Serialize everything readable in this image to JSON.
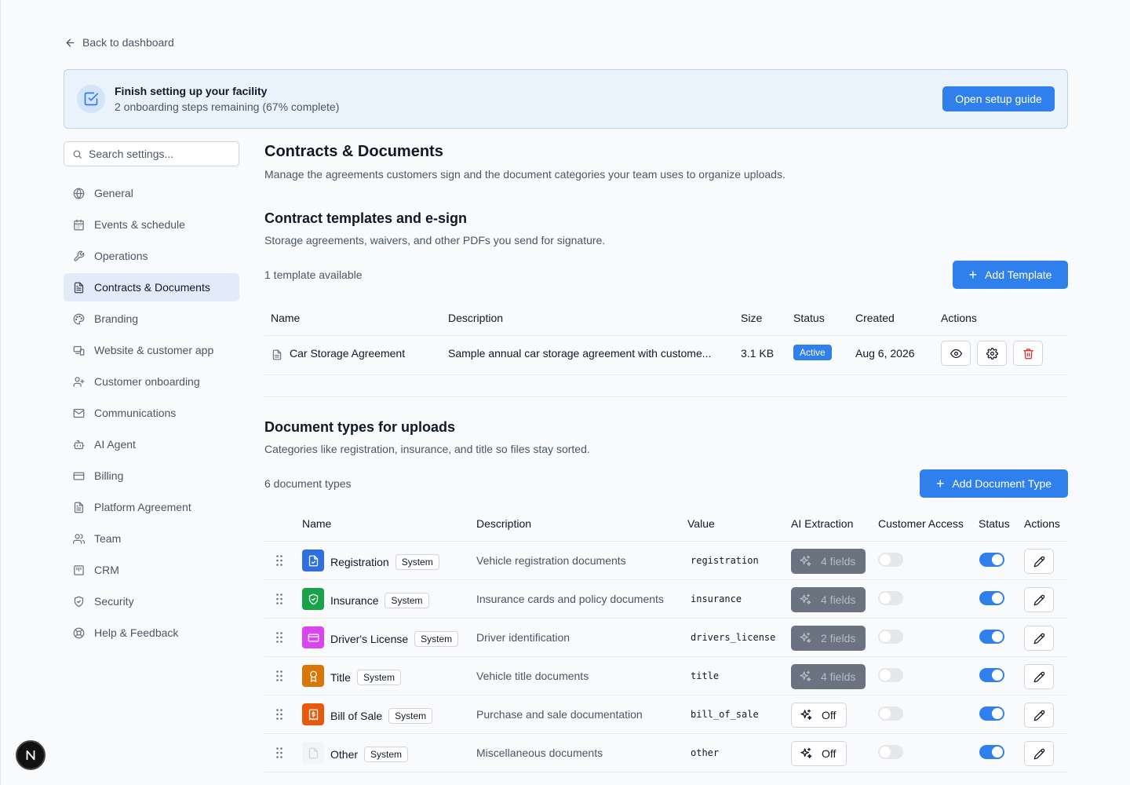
{
  "back_link": "Back to dashboard",
  "banner": {
    "title": "Finish setting up your facility",
    "subtitle": "2 onboarding steps remaining (67% complete)",
    "button": "Open setup guide"
  },
  "search": {
    "placeholder": "Search settings..."
  },
  "sidebar": {
    "items": [
      {
        "label": "General",
        "icon": "globe-icon"
      },
      {
        "label": "Events & schedule",
        "icon": "calendar-icon"
      },
      {
        "label": "Operations",
        "icon": "wrench-icon"
      },
      {
        "label": "Contracts & Documents",
        "icon": "file-text-icon",
        "active": true
      },
      {
        "label": "Branding",
        "icon": "palette-icon"
      },
      {
        "label": "Website & customer app",
        "icon": "devices-icon"
      },
      {
        "label": "Customer onboarding",
        "icon": "user-plus-icon"
      },
      {
        "label": "Communications",
        "icon": "mail-icon"
      },
      {
        "label": "AI Agent",
        "icon": "bot-icon"
      },
      {
        "label": "Billing",
        "icon": "credit-card-icon"
      },
      {
        "label": "Platform Agreement",
        "icon": "file-text-icon"
      },
      {
        "label": "Team",
        "icon": "users-icon"
      },
      {
        "label": "CRM",
        "icon": "contact-icon"
      },
      {
        "label": "Security",
        "icon": "shield-icon"
      },
      {
        "label": "Help & Feedback",
        "icon": "lifebuoy-icon"
      }
    ]
  },
  "page": {
    "title": "Contracts & Documents",
    "subtitle": "Manage the agreements customers sign and the document categories your team uses to organize uploads."
  },
  "templates": {
    "title": "Contract templates and e-sign",
    "subtitle": "Storage agreements, waivers, and other PDFs you send for signature.",
    "count": "1 template available",
    "add_button": "Add Template",
    "columns": [
      "Name",
      "Description",
      "Size",
      "Status",
      "Created",
      "Actions"
    ],
    "rows": [
      {
        "name": "Car Storage Agreement",
        "description": "Sample annual car storage agreement with custome...",
        "size": "3.1 KB",
        "status": "Active",
        "created": "Aug 6, 2026"
      }
    ]
  },
  "doc_types": {
    "title": "Document types for uploads",
    "subtitle": "Categories like registration, insurance, and title so files stay sorted.",
    "count": "6 document types",
    "add_button": "Add Document Type",
    "columns": [
      "Name",
      "Description",
      "Value",
      "AI Extraction",
      "Customer Access",
      "Status",
      "Actions"
    ],
    "rows": [
      {
        "name": "Registration",
        "tag": "System",
        "description": "Vehicle registration documents",
        "value": "registration",
        "ai": "4 fields",
        "ai_on": true,
        "customer_access": false,
        "status": true,
        "icon_color": "#2f6fdf",
        "icon": "file-check-icon"
      },
      {
        "name": "Insurance",
        "tag": "System",
        "description": "Insurance cards and policy documents",
        "value": "insurance",
        "ai": "4 fields",
        "ai_on": true,
        "customer_access": false,
        "status": true,
        "icon_color": "#16a34a",
        "icon": "shield-icon"
      },
      {
        "name": "Driver's License",
        "tag": "System",
        "description": "Driver identification",
        "value": "drivers_license",
        "ai": "2 fields",
        "ai_on": true,
        "customer_access": false,
        "status": true,
        "icon_color": "#d946ef",
        "icon": "id-card-icon"
      },
      {
        "name": "Title",
        "tag": "System",
        "description": "Vehicle title documents",
        "value": "title",
        "ai": "4 fields",
        "ai_on": true,
        "customer_access": false,
        "status": true,
        "icon_color": "#d97706",
        "icon": "award-icon"
      },
      {
        "name": "Bill of Sale",
        "tag": "System",
        "description": "Purchase and sale documentation",
        "value": "bill_of_sale",
        "ai": "Off",
        "ai_on": false,
        "customer_access": false,
        "status": true,
        "icon_color": "#ea580c",
        "icon": "receipt-icon"
      },
      {
        "name": "Other",
        "tag": "System",
        "description": "Miscellaneous documents",
        "value": "other",
        "ai": "Off",
        "ai_on": false,
        "customer_access": false,
        "status": true,
        "icon_color": "#f3f4f6",
        "icon": "file-icon"
      }
    ]
  }
}
